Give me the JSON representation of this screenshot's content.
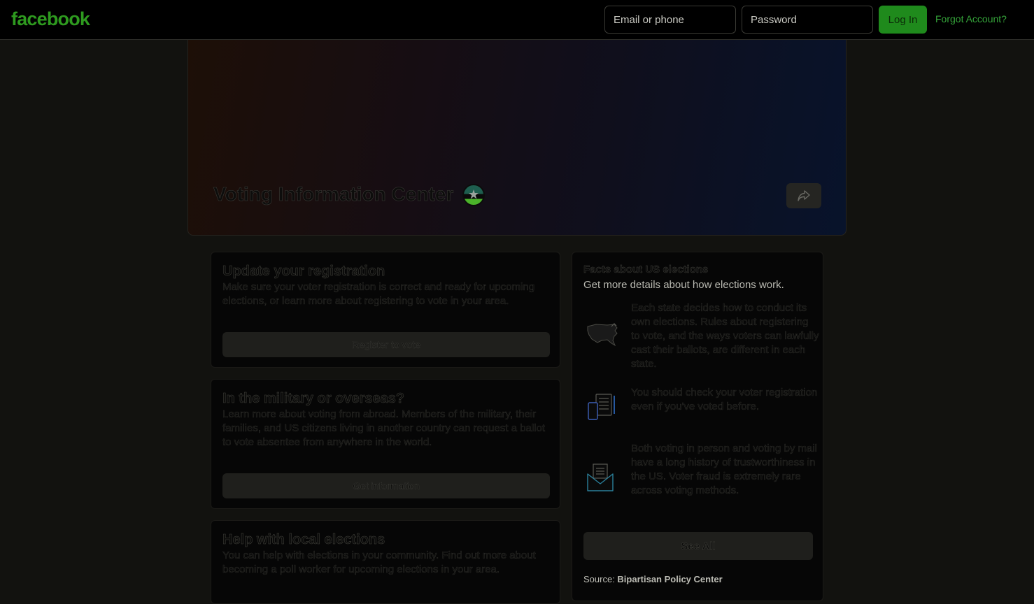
{
  "header": {
    "logo": "facebook",
    "email_placeholder": "Email or phone",
    "password_placeholder": "Password",
    "login_label": "Log In",
    "forgot_label": "Forgot Account?"
  },
  "cover": {
    "title": "Voting Information Center",
    "share_icon": "share-icon"
  },
  "cards": [
    {
      "title": "Update your registration",
      "body": "Make sure your voter registration is correct and ready for upcoming elections, or learn more about registering to vote in your area.",
      "action": "Register to vote"
    },
    {
      "title": "In the military or overseas?",
      "body": "Learn more about voting from abroad. Members of the military, their families, and US citizens living in another country can request a ballot to vote absentee from anywhere in the world.",
      "action": "Get information"
    },
    {
      "title": "Help with local elections",
      "body": "You can help with elections in your community. Find out more about becoming a poll worker for upcoming elections in your area."
    }
  ],
  "facts": {
    "title": "Facts about US elections",
    "subtitle": "Get more details about how elections work.",
    "items": [
      {
        "icon": "us-map-icon",
        "text": "Each state decides how to conduct its own elections. Rules about registering to vote, and the ways voters can lawfully cast their ballots, are different in each state."
      },
      {
        "icon": "phone-document-icon",
        "text": "You should check your voter registration even if you've voted before."
      },
      {
        "icon": "mail-ballot-icon",
        "text": "Both voting in person and voting by mail have a long history of trustworthiness in the US. Voter fraud is extremely rare across voting methods."
      }
    ],
    "see_all": "See All",
    "source_prefix": "Source: ",
    "source_name": "Bipartisan Policy Center"
  },
  "colors": {
    "brand_green": "#2e9a1f",
    "login_green": "#1f8a1c",
    "page_bg": "#12120f"
  }
}
